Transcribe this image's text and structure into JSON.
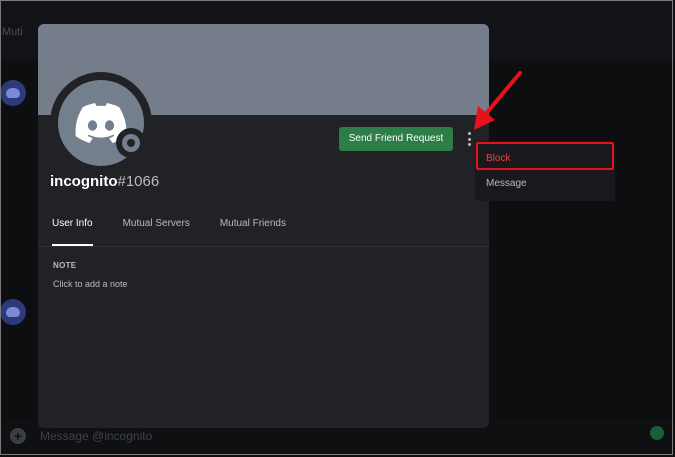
{
  "background": {
    "label": "Muti",
    "message_placeholder": "Message @incognito",
    "add_icon": "plus-icon"
  },
  "profile": {
    "username": "incognito",
    "discriminator": "#1066",
    "send_friend_request_label": "Send Friend Request",
    "more_icon": "vertical-dots-icon",
    "avatar_icon": "discord-logo-icon",
    "status_icon": "offline-status-icon",
    "tabs": [
      {
        "label": "User Info",
        "active": true
      },
      {
        "label": "Mutual Servers",
        "active": false
      },
      {
        "label": "Mutual Friends",
        "active": false
      }
    ],
    "note_label": "NOTE",
    "note_placeholder": "Click to add a note"
  },
  "context_menu": {
    "items": [
      {
        "label": "Block",
        "color": "#ed4245"
      },
      {
        "label": "Message",
        "color": "#b9bbbe"
      }
    ]
  },
  "colors": {
    "banner": "#757c8a",
    "accent_green": "#2d7d46",
    "annotation_red": "#e8101d"
  }
}
